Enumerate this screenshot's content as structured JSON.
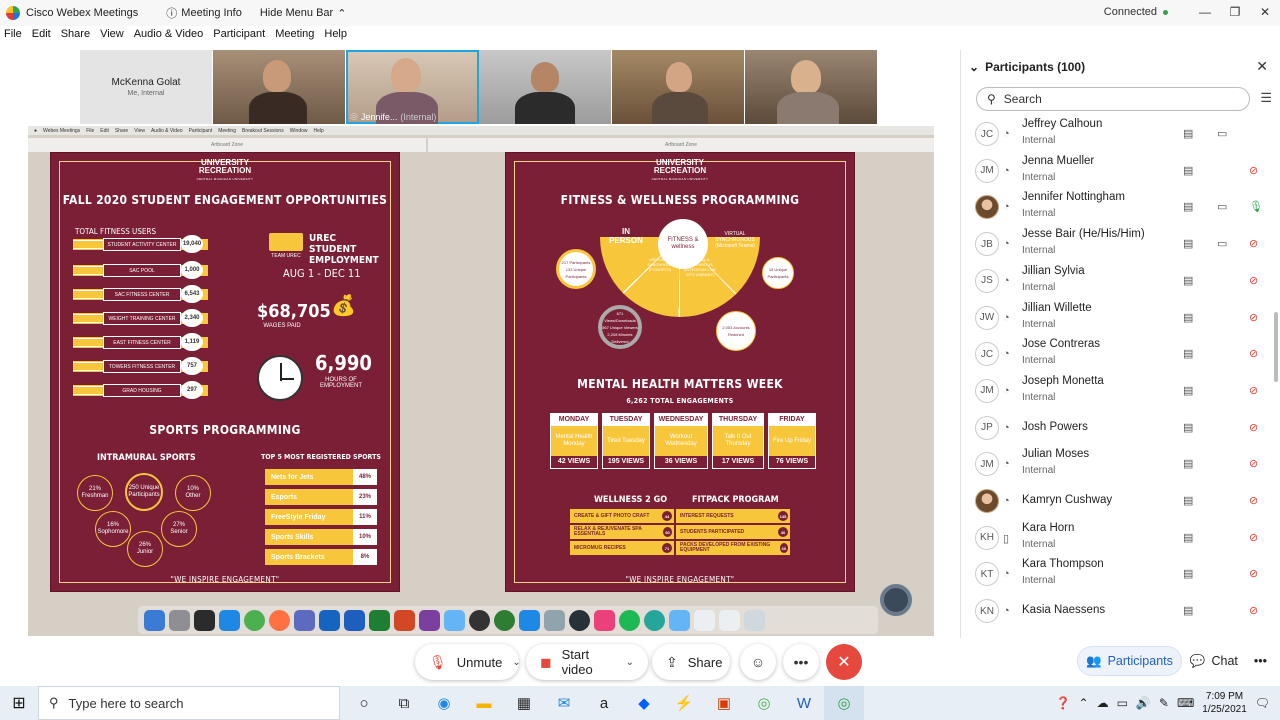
{
  "titlebar": {
    "app_title": "Cisco Webex Meetings",
    "meeting_info": "Meeting Info",
    "hide_menu_bar": "Hide Menu Bar",
    "status": "Connected"
  },
  "menu": [
    "File",
    "Edit",
    "Share",
    "View",
    "Audio & Video",
    "Participant",
    "Meeting",
    "Help"
  ],
  "video_strip": {
    "self_name": "McKenna Golat",
    "self_sub": "Me, Internal",
    "active_label": "Jennife...",
    "active_sub": "(Internal)"
  },
  "shared_content": {
    "left_poster": {
      "logo": "UNIVERSITY RECREATION",
      "logo_sub": "CENTRAL MICHIGAN UNIVERSITY",
      "title": "FALL 2020 STUDENT ENGAGEMENT OPPORTUNITIES",
      "total_users_label": "TOTAL FITNESS USERS",
      "facilities": [
        {
          "name": "STUDENT ACTIVITY CENTER",
          "count": "19,040"
        },
        {
          "name": "SAC POOL",
          "count": "1,000"
        },
        {
          "name": "SAC FITNESS CENTER",
          "count": "6,543"
        },
        {
          "name": "WEIGHT TRAINING CENTER",
          "count": "2,340"
        },
        {
          "name": "EAST FITNESS CENTER",
          "count": "1,119"
        },
        {
          "name": "TOWERS FITNESS CENTER",
          "count": "757"
        },
        {
          "name": "GRAD HOUSING",
          "count": "297"
        }
      ],
      "team_urec": "TEAM UREC",
      "employment_title": "UREC STUDENT EMPLOYMENT",
      "date_range": "AUG 1 - DEC 11",
      "wages_amount": "$68,705",
      "wages_label": "WAGES PAID",
      "hours_amount": "6,990",
      "hours_label": "HOURS OF EMPLOYMENT",
      "sports_title": "SPORTS PROGRAMMING",
      "intramural_title": "INTRAMURAL SPORTS",
      "intramural": [
        {
          "pct": "21%",
          "label": "Freshman"
        },
        {
          "pct": "250 Unique",
          "label": "Participants"
        },
        {
          "pct": "10%",
          "label": "Other"
        },
        {
          "pct": "16%",
          "label": "Sophomore"
        },
        {
          "pct": "27%",
          "label": "Senior"
        },
        {
          "pct": "26%",
          "label": "Junior"
        }
      ],
      "top5_title": "TOP 5 MOST REGISTERED SPORTS",
      "top5": [
        {
          "name": "Nets for Jets",
          "pct": "48%"
        },
        {
          "name": "Esports",
          "pct": "23%"
        },
        {
          "name": "FreeStyle Friday",
          "pct": "11%"
        },
        {
          "name": "Sports Skills",
          "pct": "10%"
        },
        {
          "name": "Sports Brackets",
          "pct": "8%"
        }
      ],
      "footer": "\"WE INSPIRE ENGAGEMENT\""
    },
    "right_poster": {
      "logo": "UNIVERSITY RECREATION",
      "logo_sub": "CENTRAL MICHIGAN UNIVERSITY",
      "title": "FITNESS & WELLNESS PROGRAMMING",
      "center_label": "FITNESS & wellness",
      "segments": [
        "IN PERSON",
        "VIRTUAL A-SYNCHROUS (PONOPTO)",
        "VIRTUAL A-SYNCHROUS (INTEGRAM LIVE IGTV LIBRARY)",
        "VIRTUAL SYNCHRONOUS (Microsoft Teams)"
      ],
      "stat_left": "217 Participants 133 Unique Participants",
      "stat_right": "15 Unique Participants",
      "stat_views": "671 Views/Downloads 567 Unique Viewers 2,208 Minutes Delivered",
      "stat_reach": "2,053 Accounts Reached",
      "mh_title": "MENTAL HEALTH MATTERS WEEK",
      "mh_total": "6,262 TOTAL ENGAGEMENTS",
      "mh_days": [
        {
          "day": "MONDAY",
          "topic": "Mental Health Monday",
          "views": "42 VIEWS"
        },
        {
          "day": "TUESDAY",
          "topic": "Tired Tuesday",
          "views": "195 VIEWS"
        },
        {
          "day": "WEDNESDAY",
          "topic": "Workout Wednesday",
          "views": "36 VIEWS"
        },
        {
          "day": "THURSDAY",
          "topic": "Talk It Out Thursday",
          "views": "17 VIEWS"
        },
        {
          "day": "FRIDAY",
          "topic": "Fire Up Friday",
          "views": "76 VIEWS"
        }
      ],
      "w2g_title": "WELLNESS 2 GO",
      "w2g": [
        {
          "label": "CREATE & GIFT PHOTO CRAFT",
          "n": "44"
        },
        {
          "label": "RELAX & REJUVENATE SPA ESSENTIALS",
          "n": "60"
        },
        {
          "label": "MICROMUG RECIPES",
          "n": "71"
        }
      ],
      "fitpack_title": "FITPACK PROGRAM",
      "fitpack": [
        {
          "label": "INTEREST REQUESTS",
          "n": "145"
        },
        {
          "label": "STUDENTS PARTICIPATED",
          "n": "40"
        },
        {
          "label": "PACKS DEVELOPED FROM EXISTING EQUIPMENT",
          "n": "60"
        }
      ],
      "footer": "\"WE INSPIRE ENGAGEMENT\""
    }
  },
  "controls": {
    "unmute": "Unmute",
    "start_video": "Start video",
    "share": "Share",
    "participants_tab": "Participants",
    "chat_tab": "Chat"
  },
  "participants_panel": {
    "header": "Participants (100)",
    "search_placeholder": "Search",
    "list": [
      {
        "initials": "JC",
        "name": "Jeffrey Calhoun",
        "role": "Internal",
        "video": true,
        "mic": "none"
      },
      {
        "initials": "JM",
        "name": "Jenna Mueller",
        "role": "Internal",
        "video": false,
        "mic": "muted"
      },
      {
        "initials": "",
        "name": "Jennifer Nottingham",
        "role": "Internal",
        "video": true,
        "mic": "on",
        "photo": true
      },
      {
        "initials": "JB",
        "name": "Jesse Bair (He/His/Him)",
        "role": "Internal",
        "video": true,
        "mic": "muted"
      },
      {
        "initials": "JS",
        "name": "Jillian Sylvia",
        "role": "Internal",
        "video": false,
        "mic": "muted"
      },
      {
        "initials": "JW",
        "name": "Jillian Willette",
        "role": "Internal",
        "video": false,
        "mic": "muted"
      },
      {
        "initials": "JC",
        "name": "Jose Contreras",
        "role": "Internal",
        "video": false,
        "mic": "muted"
      },
      {
        "initials": "JM",
        "name": "Joseph Monetta",
        "role": "Internal",
        "video": false,
        "mic": "muted"
      },
      {
        "initials": "JP",
        "name": "Josh Powers",
        "role": "",
        "video": false,
        "mic": "muted"
      },
      {
        "initials": "JM",
        "name": "Julian Moses",
        "role": "Internal",
        "video": false,
        "mic": "muted"
      },
      {
        "initials": "",
        "name": "Kamryn Cushway",
        "role": "",
        "video": false,
        "mic": "muted",
        "photo": true
      },
      {
        "initials": "KH",
        "name": "Kara Horn",
        "role": "Internal",
        "video": false,
        "mic": "muted",
        "phone": true
      },
      {
        "initials": "KT",
        "name": "Kara Thompson",
        "role": "Internal",
        "video": false,
        "mic": "muted"
      },
      {
        "initials": "KN",
        "name": "Kasia Naessens",
        "role": "",
        "video": false,
        "mic": "muted"
      }
    ]
  },
  "taskbar": {
    "search_placeholder": "Type here to search",
    "time": "7:09 PM",
    "date": "1/25/2021"
  }
}
